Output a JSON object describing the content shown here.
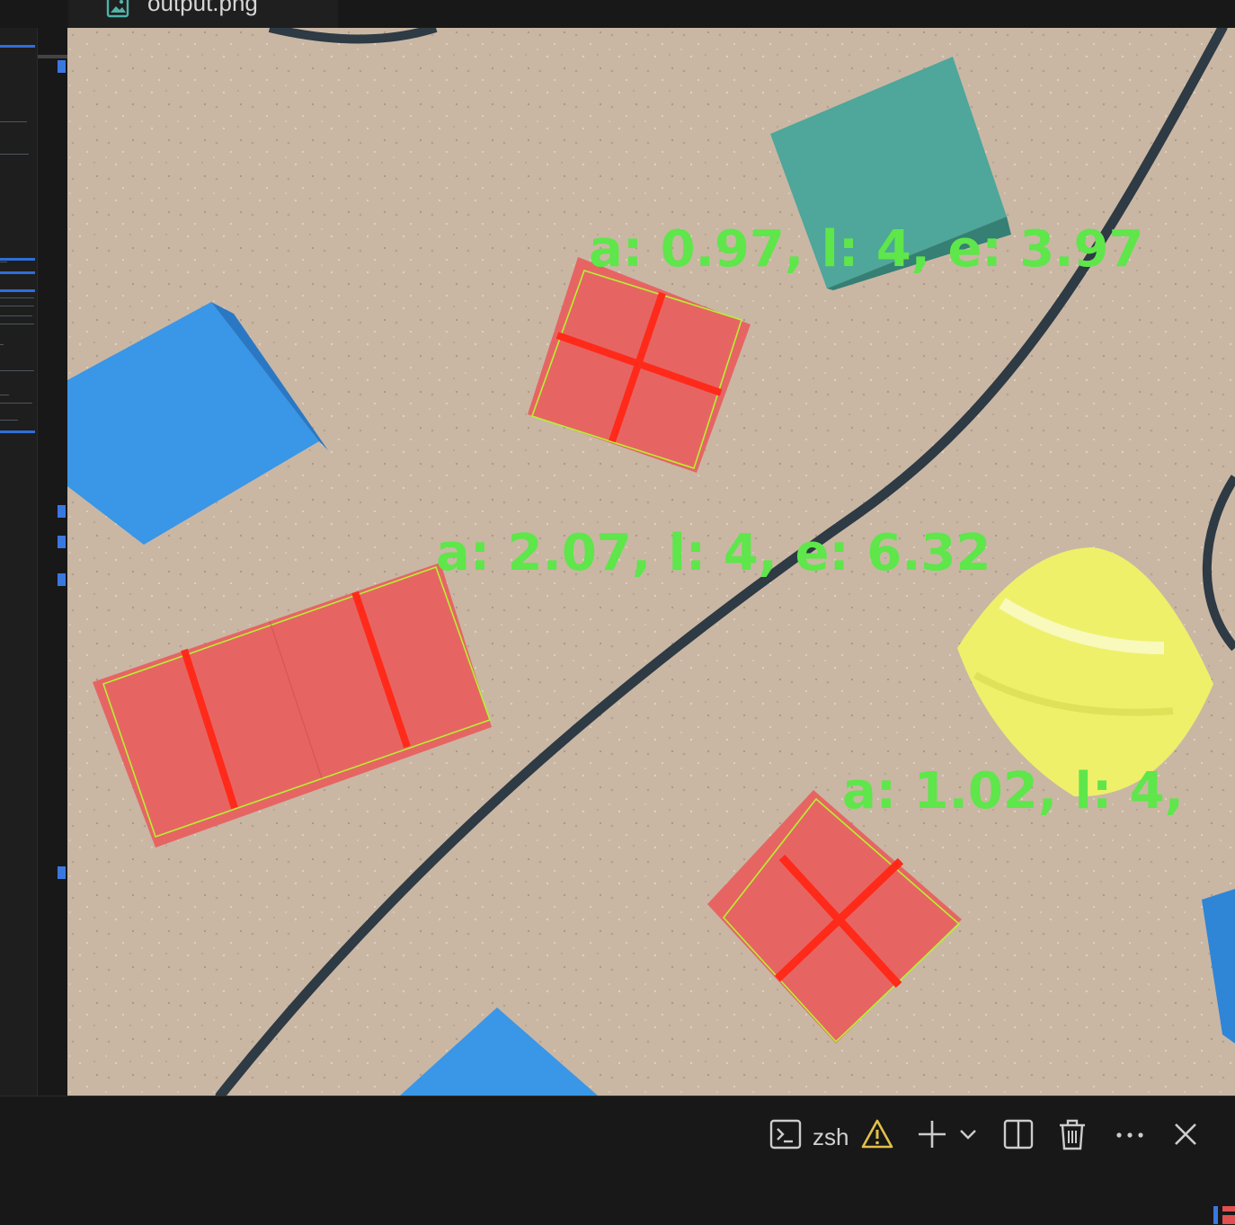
{
  "editor": {
    "tab": {
      "label": "output.png",
      "icon": "image-file-icon"
    }
  },
  "image": {
    "annotations": [
      {
        "text": "a: 0.97, l: 4, e: 3.97"
      },
      {
        "text": "a: 2.07, l: 4, e: 6.32"
      },
      {
        "text": "a: 1.02, l: 4,"
      }
    ],
    "colors": {
      "label_green": "#5ee64a",
      "box_outline": "#b6f230",
      "cross_red": "#ff2a1a",
      "red_block": "#e86060",
      "blue_block": "#3a96e6",
      "teal_block": "#4fa69a",
      "yellow_block": "#eef06a",
      "cable": "#2e3a44",
      "table": "#cbb9a6"
    }
  },
  "panel": {
    "terminal_name": "zsh",
    "icons": [
      "terminal-icon",
      "warning-icon",
      "plus-icon",
      "chevron-down-icon",
      "split-icon",
      "trash-icon",
      "more-icon",
      "close-icon"
    ],
    "warning_color": "#e2c04a"
  }
}
